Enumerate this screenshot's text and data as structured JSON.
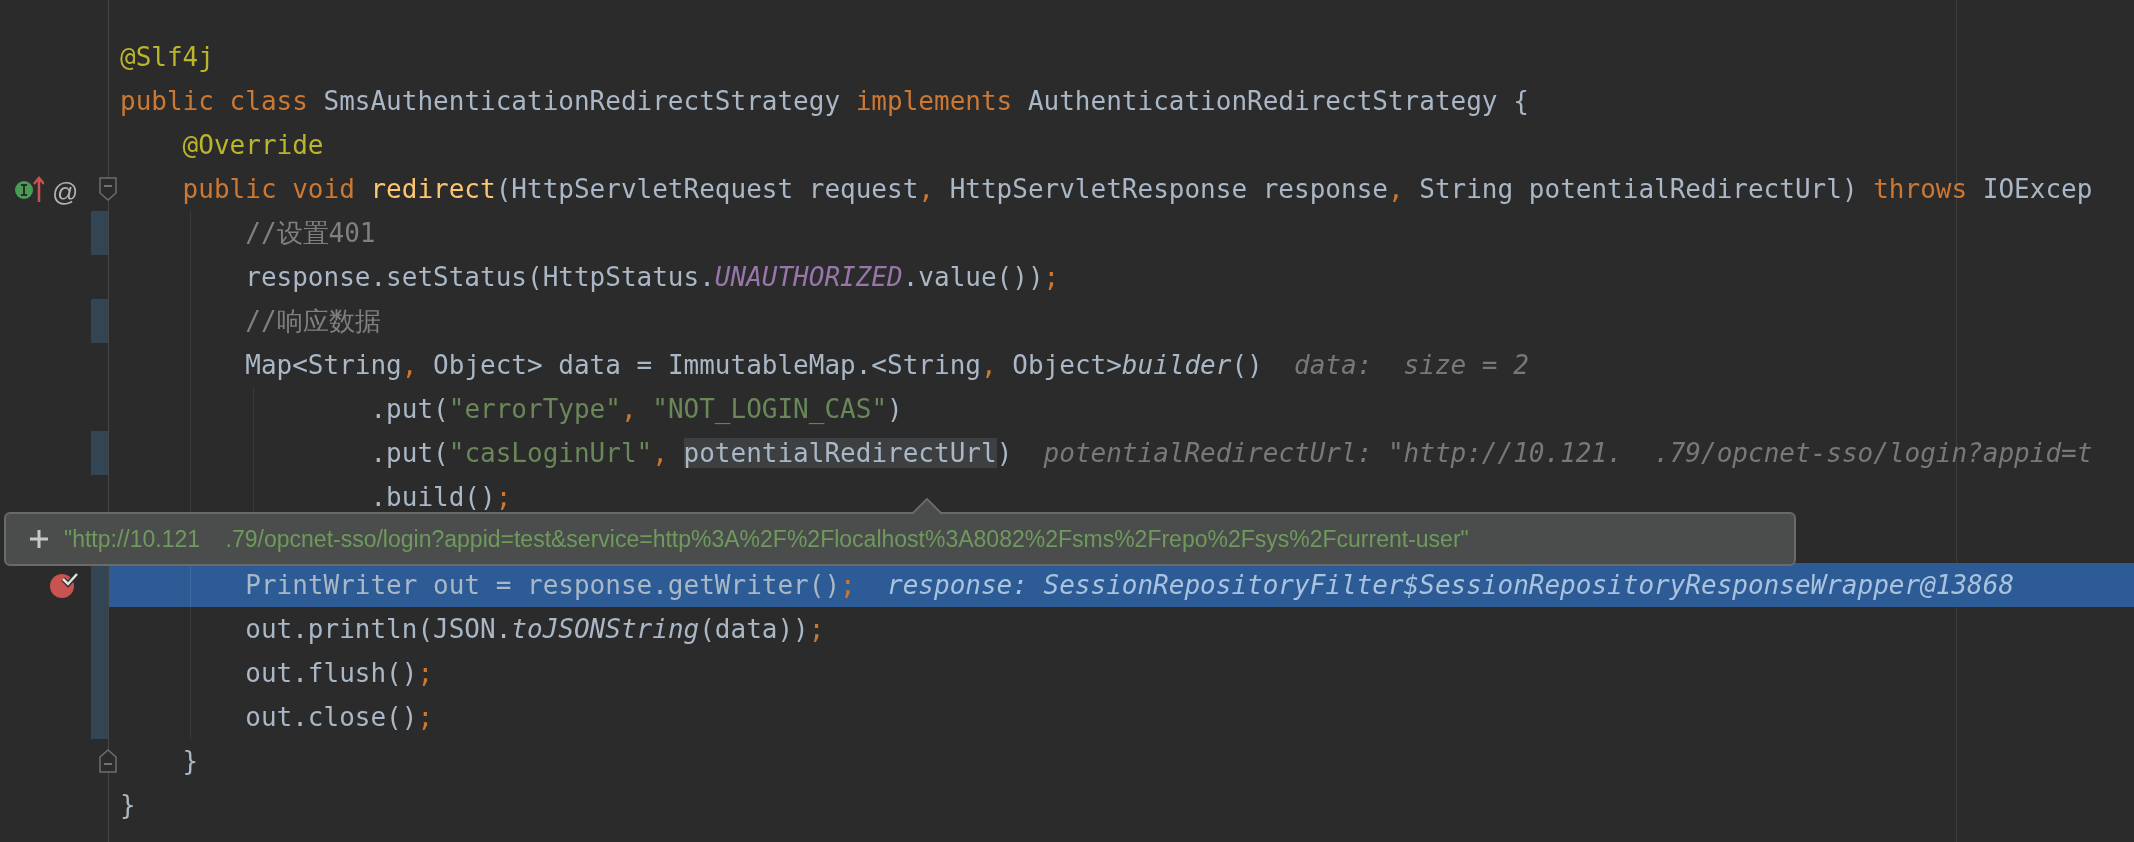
{
  "lines": [
    {
      "tokens": [
        {
          "kind": "annotation",
          "text": "@Slf4j"
        }
      ],
      "changed": false,
      "selected": false,
      "breakpoint": false,
      "implements_marker": false,
      "fold_start": false,
      "fold_end": false
    },
    {
      "tokens": [
        {
          "kind": "keyword",
          "text": "public class "
        },
        {
          "kind": "plain",
          "text": "SmsAuthenticationRedirectStrategy "
        },
        {
          "kind": "keyword",
          "text": "implements "
        },
        {
          "kind": "plain",
          "text": "AuthenticationRedirectStrategy {"
        }
      ],
      "changed": false,
      "selected": false,
      "breakpoint": false,
      "implements_marker": false,
      "fold_start": false,
      "fold_end": false
    },
    {
      "tokens": [
        {
          "kind": "annotation",
          "text": "    @Override"
        }
      ],
      "changed": false,
      "selected": false,
      "breakpoint": false,
      "implements_marker": false,
      "fold_start": false,
      "fold_end": false
    },
    {
      "tokens": [
        {
          "kind": "keyword",
          "text": "    public void "
        },
        {
          "kind": "method",
          "text": "redirect"
        },
        {
          "kind": "plain",
          "text": "(HttpServletRequest request"
        },
        {
          "kind": "keyword",
          "text": ", "
        },
        {
          "kind": "plain",
          "text": "HttpServletResponse response"
        },
        {
          "kind": "keyword",
          "text": ", "
        },
        {
          "kind": "plain",
          "text": "String potentialRedirectUrl) "
        },
        {
          "kind": "keyword",
          "text": "throws "
        },
        {
          "kind": "plain",
          "text": "IOExcep"
        }
      ],
      "changed": false,
      "selected": false,
      "breakpoint": false,
      "implements_marker": true,
      "gutter_text": "@",
      "fold_start": true,
      "fold_end": false
    },
    {
      "tokens": [
        {
          "kind": "comment",
          "text": "        //设置401"
        }
      ],
      "changed": true,
      "selected": false,
      "breakpoint": false,
      "implements_marker": false,
      "fold_start": false,
      "fold_end": false
    },
    {
      "tokens": [
        {
          "kind": "plain",
          "text": "        response.setStatus(HttpStatus."
        },
        {
          "kind": "constant",
          "text": "UNAUTHORIZED"
        },
        {
          "kind": "plain",
          "text": ".value())"
        },
        {
          "kind": "keyword",
          "text": ";"
        }
      ],
      "changed": false,
      "selected": false,
      "breakpoint": false,
      "implements_marker": false,
      "fold_start": false,
      "fold_end": false
    },
    {
      "tokens": [
        {
          "kind": "comment",
          "text": "        //响应数据"
        }
      ],
      "changed": true,
      "selected": false,
      "breakpoint": false,
      "implements_marker": false,
      "fold_start": false,
      "fold_end": false
    },
    {
      "tokens": [
        {
          "kind": "plain",
          "text": "        Map<String"
        },
        {
          "kind": "keyword",
          "text": ", "
        },
        {
          "kind": "plain",
          "text": "Object> data = ImmutableMap.<String"
        },
        {
          "kind": "keyword",
          "text": ", "
        },
        {
          "kind": "plain",
          "text": "Object>"
        },
        {
          "kind": "static",
          "text": "builder"
        },
        {
          "kind": "plain",
          "text": "()"
        }
      ],
      "hint": "data:  size = 2",
      "changed": false,
      "selected": false,
      "breakpoint": false,
      "implements_marker": false,
      "fold_start": false,
      "fold_end": false
    },
    {
      "tokens": [
        {
          "kind": "plain",
          "text": "                .put("
        },
        {
          "kind": "string",
          "text": "\"errorType\""
        },
        {
          "kind": "keyword",
          "text": ", "
        },
        {
          "kind": "string",
          "text": "\"NOT_LOGIN_CAS\""
        },
        {
          "kind": "plain",
          "text": ")"
        }
      ],
      "changed": false,
      "selected": false,
      "breakpoint": false,
      "implements_marker": false,
      "fold_start": false,
      "fold_end": false
    },
    {
      "tokens": [
        {
          "kind": "plain",
          "text": "                .put("
        },
        {
          "kind": "string",
          "text": "\"casLoginUrl\""
        },
        {
          "kind": "keyword",
          "text": ", "
        },
        {
          "kind": "reference",
          "text": "potentialRedirectUrl"
        },
        {
          "kind": "plain",
          "text": ")"
        }
      ],
      "hint": "potentialRedirectUrl: \"http://10.121.  .79/opcnet-sso/login?appid=t",
      "changed": true,
      "selected": false,
      "breakpoint": false,
      "implements_marker": false,
      "fold_start": false,
      "fold_end": false
    },
    {
      "tokens": [
        {
          "kind": "plain",
          "text": "                .build()"
        },
        {
          "kind": "keyword",
          "text": ";"
        }
      ],
      "changed": false,
      "selected": false,
      "breakpoint": false,
      "implements_marker": false,
      "fold_start": false,
      "fold_end": false
    },
    {
      "changed": false,
      "selected": false,
      "breakpoint": false,
      "implements_marker": false,
      "fold_start": false,
      "fold_end": false
    },
    {
      "tokens": [
        {
          "kind": "plain",
          "text": "        PrintWriter out = response.getWriter()"
        },
        {
          "kind": "keyword",
          "text": ";"
        }
      ],
      "hint": "response: SessionRepositoryFilter$SessionRepositoryResponseWrapper@13868",
      "changed": true,
      "selected": true,
      "breakpoint": true,
      "implements_marker": false,
      "fold_start": false,
      "fold_end": false
    },
    {
      "tokens": [
        {
          "kind": "plain",
          "text": "        out.println(JSON."
        },
        {
          "kind": "static",
          "text": "toJSONString"
        },
        {
          "kind": "plain",
          "text": "(data))"
        },
        {
          "kind": "keyword",
          "text": ";"
        }
      ],
      "changed": true,
      "selected": false,
      "breakpoint": false,
      "implements_marker": false,
      "fold_start": false,
      "fold_end": false
    },
    {
      "tokens": [
        {
          "kind": "plain",
          "text": "        out.flush()"
        },
        {
          "kind": "keyword",
          "text": ";"
        }
      ],
      "changed": true,
      "selected": false,
      "breakpoint": false,
      "implements_marker": false,
      "fold_start": false,
      "fold_end": false
    },
    {
      "tokens": [
        {
          "kind": "plain",
          "text": "        out.close()"
        },
        {
          "kind": "keyword",
          "text": ";"
        }
      ],
      "changed": true,
      "selected": false,
      "breakpoint": false,
      "implements_marker": false,
      "fold_start": false,
      "fold_end": false
    },
    {
      "tokens": [
        {
          "kind": "plain",
          "text": "    }"
        }
      ],
      "changed": false,
      "selected": false,
      "breakpoint": false,
      "implements_marker": false,
      "fold_start": false,
      "fold_end": true
    },
    {
      "tokens": [
        {
          "kind": "plain",
          "text": "}"
        }
      ],
      "changed": false,
      "selected": false,
      "breakpoint": false,
      "implements_marker": false,
      "fold_start": false,
      "fold_end": false
    }
  ],
  "popup": {
    "text": "\"http://10.121    .79/opcnet-sso/login?appid=test&service=http%3A%2F%2Flocalhost%3A8082%2Fsms%2Frepo%2Fsys%2Fcurrent-user\""
  }
}
